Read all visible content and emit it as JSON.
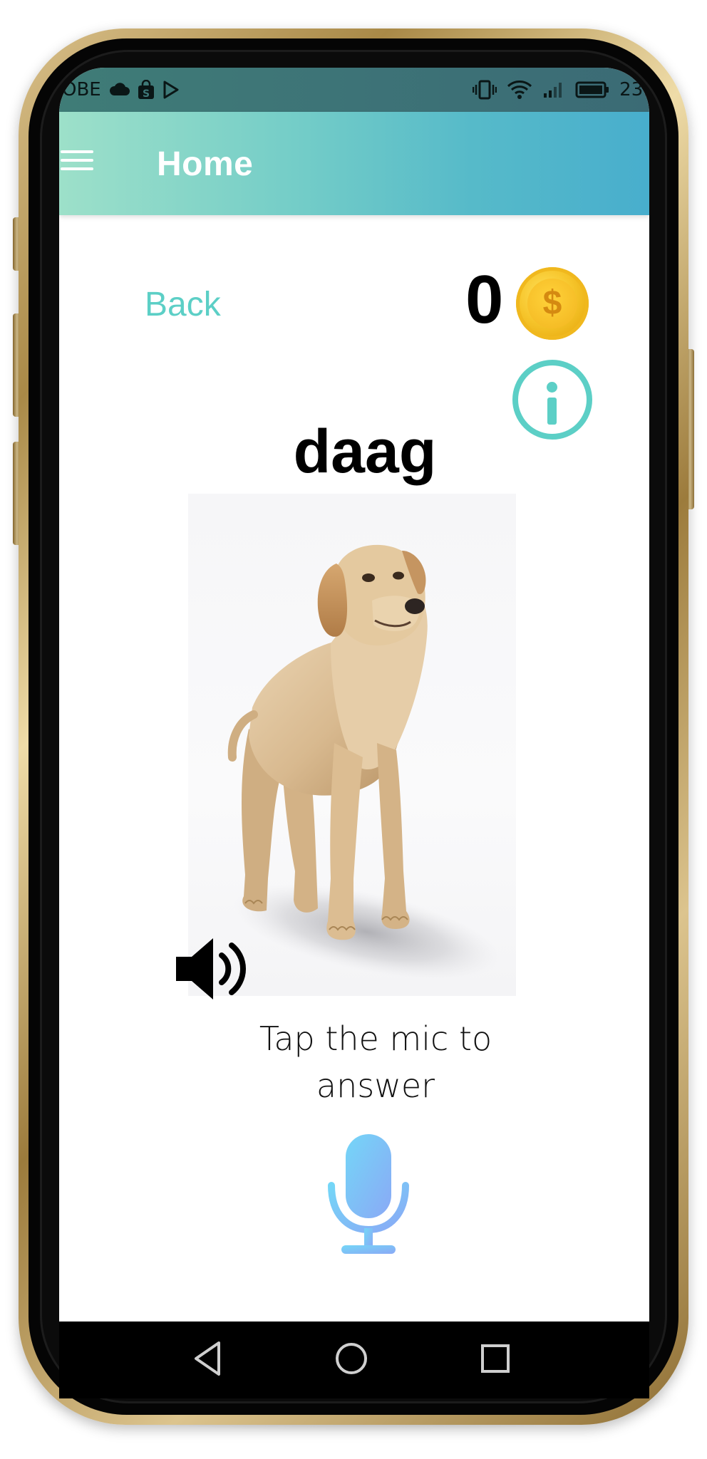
{
  "status_bar": {
    "left_text": "OBE",
    "time": "23:"
  },
  "app_bar": {
    "title": "Home"
  },
  "lesson": {
    "back_label": "Back",
    "coins": "0",
    "coin_symbol": "$",
    "word": "daag",
    "image_subject": "dog",
    "prompt_line1": "Tap the mic to",
    "prompt_line2": "answer"
  },
  "icons": {
    "menu": "hamburger-menu-icon",
    "coin": "coin-icon",
    "info": "info-icon",
    "speaker": "speaker-icon",
    "mic": "microphone-icon"
  },
  "colors": {
    "accent_teal": "#5ccfc6",
    "app_bar_start": "#9de0c9",
    "app_bar_end": "#48aecd",
    "coin_gold": "#f6c52b",
    "mic_blue": "#7cc7f5",
    "phone_gold": "#c9a85f"
  }
}
